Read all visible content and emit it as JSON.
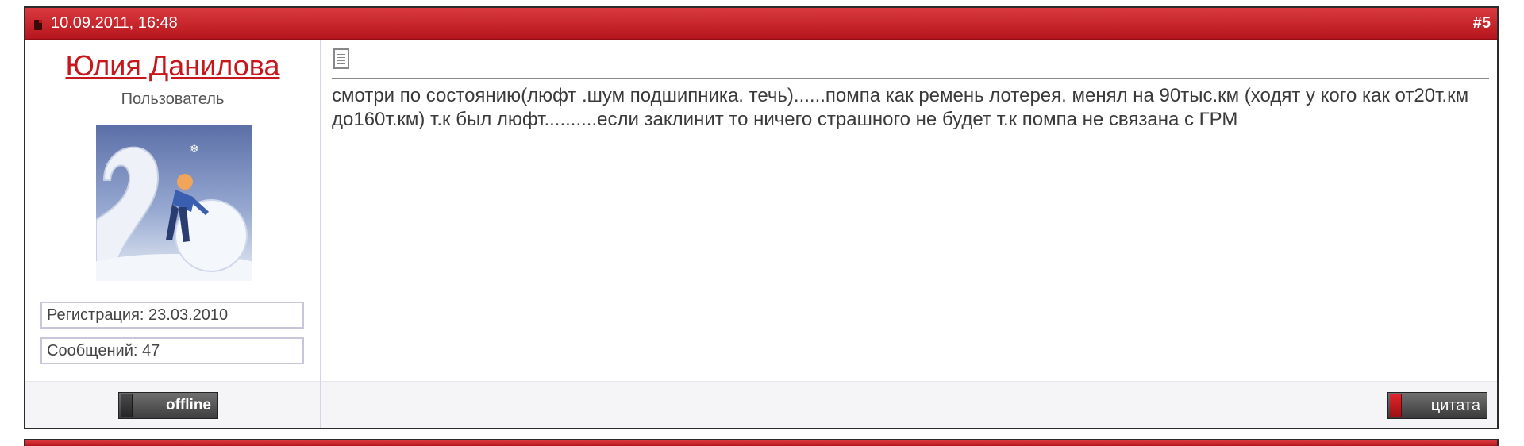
{
  "post": {
    "date": "10.09.2011, 16:48",
    "number": "#5",
    "user": {
      "name": "Юлия Данилова",
      "title": "Пользователь",
      "registration": "Регистрация: 23.03.2010",
      "messages": "Сообщений: 47",
      "status": "offline"
    },
    "message": "смотри по состоянию(люфт .шум подшипника. течь)......помпа как ремень лотерея. менял на 90тыс.км (ходят у кого как от20т.км до160т.км) т.к был люфт..........если заклинит то ничего страшного не будет т.к помпа не связана с ГРМ",
    "quote_label": "цитата"
  },
  "colors": {
    "header_red": "#c8161d",
    "username_red": "#c8161d",
    "border_lavender": "#c9c6dc"
  }
}
